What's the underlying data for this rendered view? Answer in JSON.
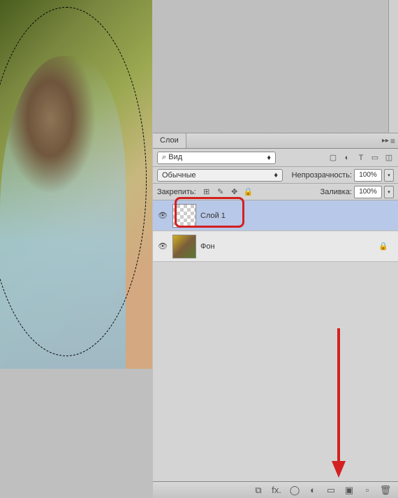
{
  "panel": {
    "tab_label": "Слои",
    "filter_label": "Вид",
    "blend_mode": "Обычные",
    "opacity_label": "Непрозрачность:",
    "opacity_value": "100%",
    "lock_label": "Закрепить:",
    "fill_label": "Заливка:",
    "fill_value": "100%"
  },
  "layers": [
    {
      "name": "Слой 1",
      "visible": true,
      "selected": true,
      "locked": false
    },
    {
      "name": "Фон",
      "visible": true,
      "selected": false,
      "locked": true
    }
  ],
  "icons": {
    "search": "⌕",
    "chevron": "▸◂",
    "image": "▢",
    "adjust": "◐",
    "type": "T",
    "shape": "▭",
    "smart": "◫",
    "menu": "≡",
    "collapse": "▸▸",
    "eye": "👁",
    "lock": "🔒",
    "pixels": "⊞",
    "brush": "✎",
    "move": "✥",
    "link": "⧉",
    "fx": "fx.",
    "mask": "◯",
    "circle": "◐",
    "folder": "▭",
    "group": "▣",
    "new": "▫",
    "trash": "🗑",
    "down": "▾"
  }
}
